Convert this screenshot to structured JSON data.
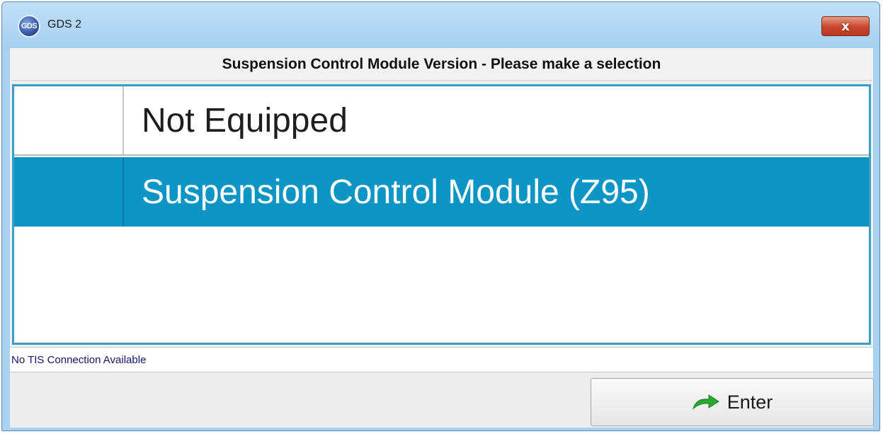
{
  "window": {
    "title": "GDS 2",
    "logo_text": "GDS",
    "close_glyph": "x"
  },
  "dialog": {
    "heading": "Suspension Control Module Version - Please make a selection",
    "options": [
      {
        "label": "Not Equipped",
        "selected": false
      },
      {
        "label": "Suspension Control Module (Z95)",
        "selected": true
      }
    ],
    "status_text": "No TIS Connection Available",
    "enter_label": "Enter",
    "enter_icon": "green-arrow-icon"
  },
  "colors": {
    "title_bar": "#a9d2f2",
    "selection": "#0d95c5",
    "list_border": "#3b9ec4",
    "close_button": "#c8452a",
    "status_text": "#14146a",
    "enter_arrow": "#27a832"
  }
}
